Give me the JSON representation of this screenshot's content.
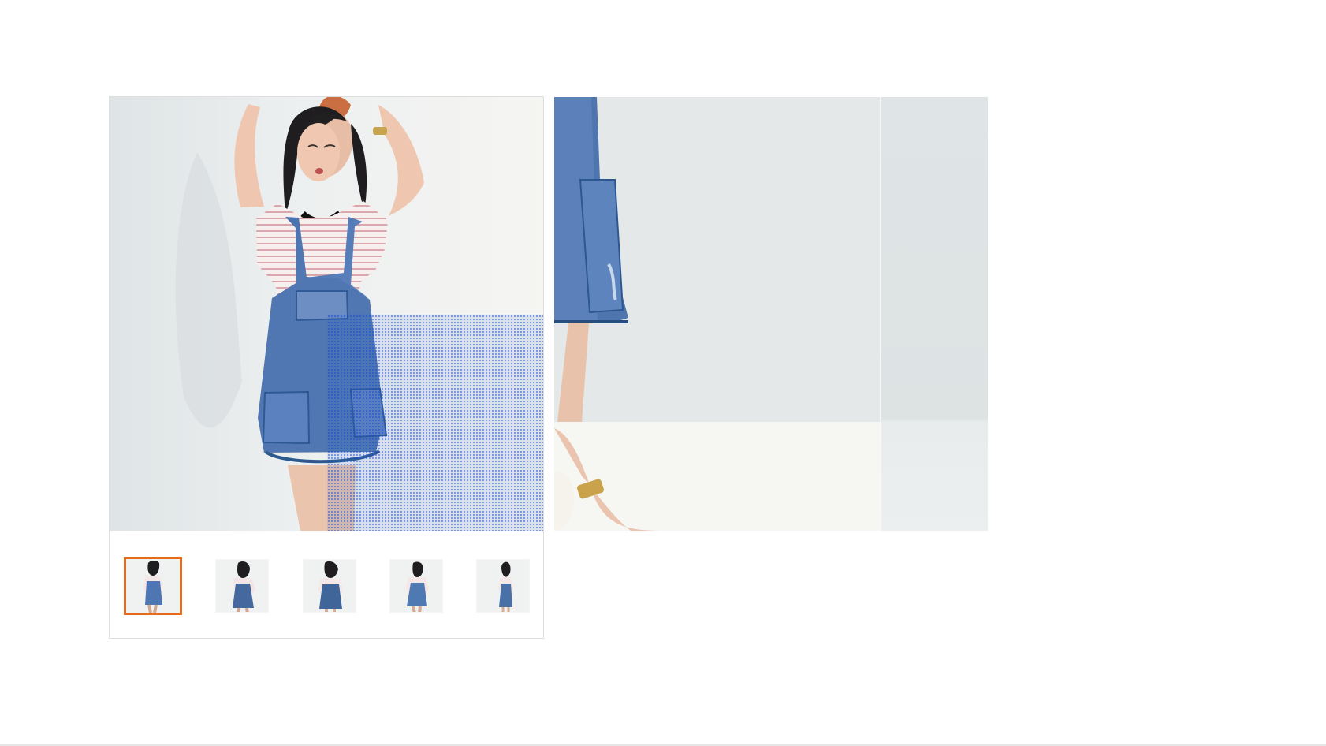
{
  "product_gallery": {
    "main_image": {
      "icon": "denim-overall-dress-photo",
      "alt": ""
    },
    "zoom_lens": {
      "color": "#3769d2"
    },
    "thumbnails": [
      {
        "icon": "denim-dress-front-thumbnail",
        "selected": true
      },
      {
        "icon": "denim-dress-hair-touch-thumbnail",
        "selected": false
      },
      {
        "icon": "denim-dress-standing-thumbnail",
        "selected": false
      },
      {
        "icon": "denim-dress-pose-thumbnail",
        "selected": false
      },
      {
        "icon": "denim-dress-side-thumbnail",
        "selected": false
      }
    ],
    "selected_color": "#e56b1f"
  },
  "zoom_preview": {
    "icon": "zoomed-denim-dress-detail"
  }
}
